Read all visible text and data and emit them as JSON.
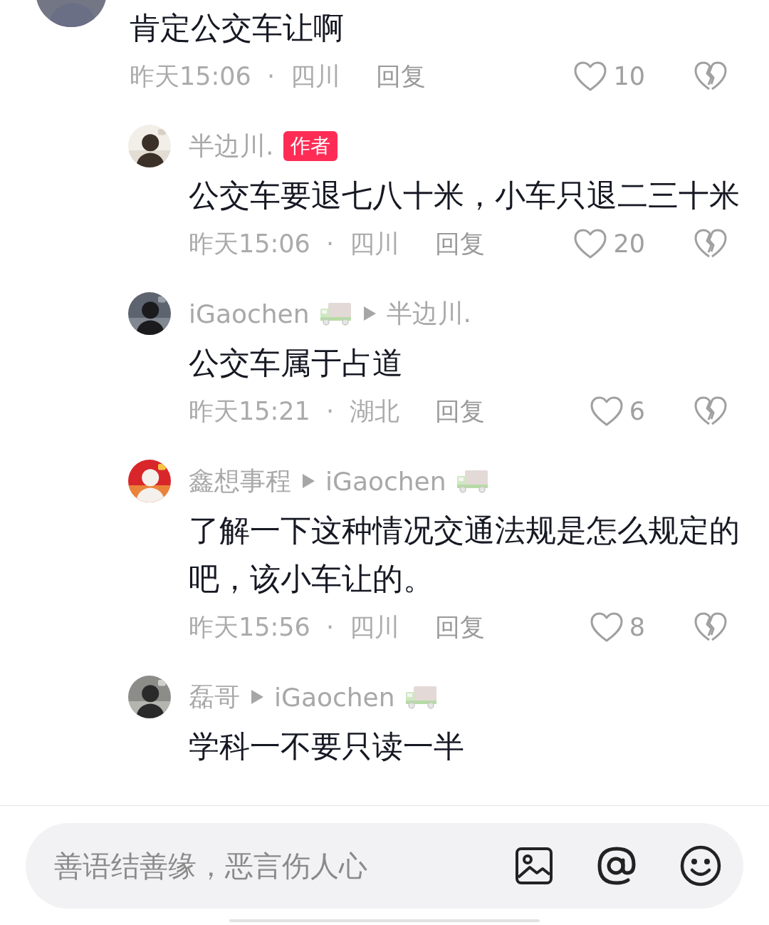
{
  "comments": [
    {
      "kind": "top",
      "text": "肯定公交车让啊",
      "time": "昨天15:06",
      "separator": "·",
      "location": "四川",
      "reply": "回复",
      "likes": "10",
      "liked": false
    },
    {
      "kind": "reply",
      "author": "半边川.",
      "author_badge": "作者",
      "text": "公交车要退七八十米，小车只退二三十米",
      "time": "昨天15:06",
      "separator": "·",
      "location": "四川",
      "reply": "回复",
      "likes": "20",
      "liked": false
    },
    {
      "kind": "reply",
      "author": "iGaochen",
      "author_vehicle": true,
      "reply_to": "半边川.",
      "text": "公交车属于占道",
      "time": "昨天15:21",
      "separator": "·",
      "location": "湖北",
      "reply": "回复",
      "likes": "6",
      "liked": false
    },
    {
      "kind": "reply",
      "author": "鑫想事程",
      "reply_to": "iGaochen",
      "reply_to_vehicle": true,
      "text": "了解一下这种情况交通法规是怎么规定的吧，该小车让的。",
      "time": "昨天15:56",
      "separator": "·",
      "location": "四川",
      "reply": "回复",
      "likes": "8",
      "liked": false
    },
    {
      "kind": "reply",
      "author": "磊哥",
      "reply_to": "iGaochen",
      "reply_to_vehicle": true,
      "text": "学科一不要只读一半"
    }
  ],
  "input": {
    "placeholder": "善语结善缘，恶言伤人心"
  }
}
